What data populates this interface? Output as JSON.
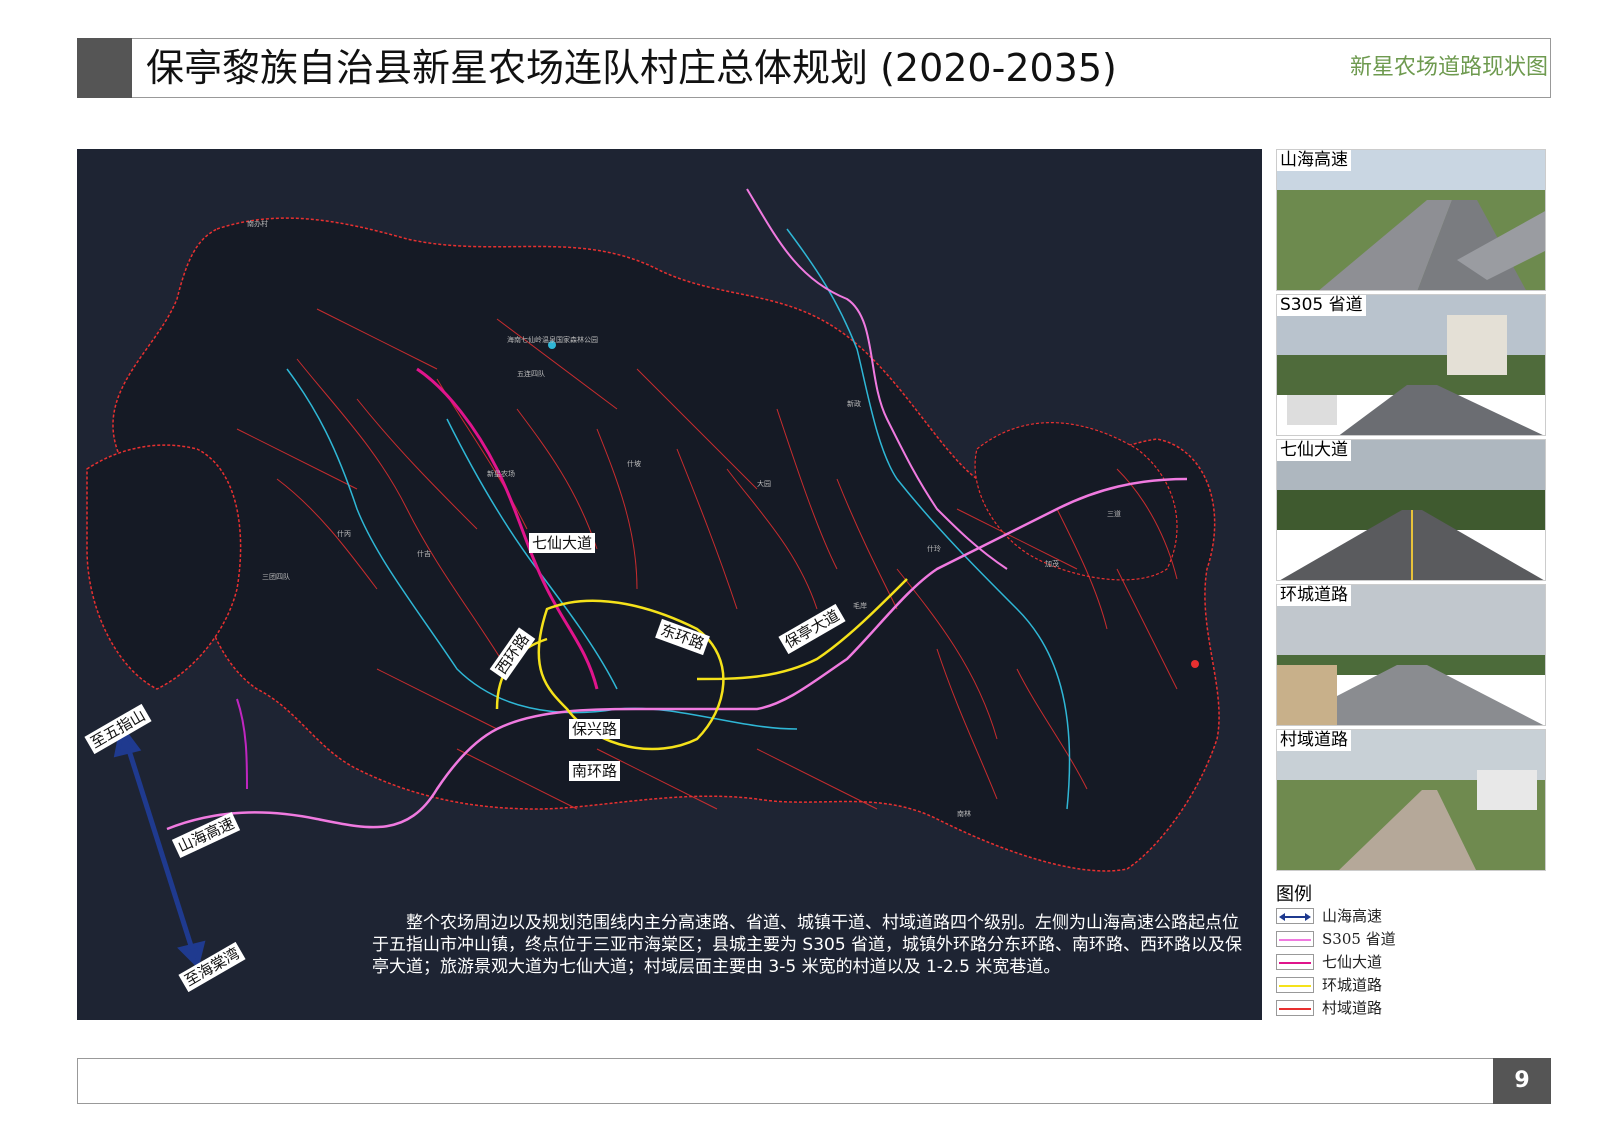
{
  "header": {
    "title": "保亭黎族自治县新星农场连队村庄总体规划 (2020-2035)",
    "subtitle": "新星农场道路现状图"
  },
  "map": {
    "road_labels": {
      "qixian": "七仙大道",
      "dong": "东环路",
      "xi": "西环路",
      "baoting": "保亭大道",
      "baoxing": "保兴路",
      "nan": "南环路",
      "shanhai": "山海高速",
      "to_wuzhishan": "至五指山",
      "to_haitang": "至海棠湾"
    },
    "place_labels": [
      "南办村",
      "新星农场",
      "海南七仙岭温泉国家森林公园",
      "五连四队",
      "三团四队",
      "什坡",
      "新政",
      "什玲",
      "加茂",
      "南林",
      "毛岸",
      "什丙",
      "大园",
      "三道",
      "什吉"
    ],
    "description": "整个农场周边以及规划范围线内主分高速路、省道、城镇干道、村域道路四个级别。左侧为山海高速公路起点位于五指山市冲山镇，终点位于三亚市海棠区；县城主要为 S305 省道，城镇外环路分东环路、南环路、西环路以及保亭大道；旅游景观大道为七仙大道；村域层面主要由 3-5 米宽的村道以及 1-2.5 米宽巷道。"
  },
  "photos": [
    {
      "label": "山海高速",
      "scene": "highway"
    },
    {
      "label": "S305 省道",
      "scene": "street"
    },
    {
      "label": "七仙大道",
      "scene": "avenue"
    },
    {
      "label": "环城道路",
      "scene": "ring"
    },
    {
      "label": "村域道路",
      "scene": "village"
    }
  ],
  "legend": {
    "title": "图例",
    "items": [
      {
        "label": "山海高速",
        "color": "#1f3a8f",
        "style": "arrow"
      },
      {
        "label": "S305 省道",
        "color": "#f07ae0",
        "style": "line"
      },
      {
        "label": "七仙大道",
        "color": "#e0148c",
        "style": "line"
      },
      {
        "label": "环城道路",
        "color": "#f5e21a",
        "style": "line"
      },
      {
        "label": "村域道路",
        "color": "#e83030",
        "style": "line"
      }
    ]
  },
  "footer": {
    "page_number": "9"
  }
}
